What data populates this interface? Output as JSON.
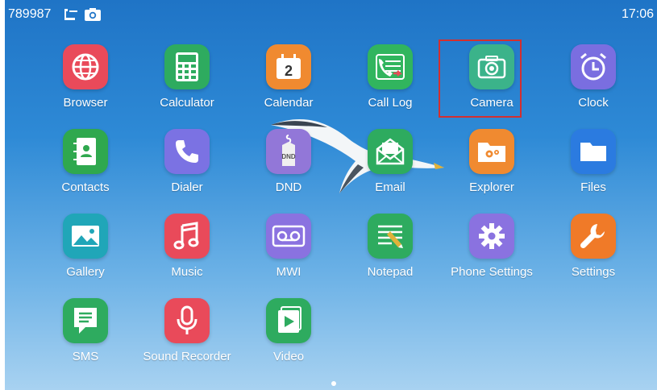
{
  "status_bar": {
    "number": "789987",
    "phone_icon": "phone-handset-icon",
    "camera_icon": "camera-status-icon",
    "time": "17:06"
  },
  "apps": [
    {
      "label": "Browser",
      "icon": "globe-icon",
      "color": "#e94a5a"
    },
    {
      "label": "Calculator",
      "icon": "calculator-icon",
      "color": "#2eab5f"
    },
    {
      "label": "Calendar",
      "icon": "calendar-icon",
      "color": "#f08a30",
      "value": "2"
    },
    {
      "label": "Call Log",
      "icon": "call-log-icon",
      "color": "#31b55e"
    },
    {
      "label": "Camera",
      "icon": "camera-icon",
      "color": "#3bb38a"
    },
    {
      "label": "Clock",
      "icon": "alarm-clock-icon",
      "color": "#7a6ee0"
    },
    {
      "label": "Contacts",
      "icon": "contacts-book-icon",
      "color": "#2fa84e"
    },
    {
      "label": "Dialer",
      "icon": "phone-icon",
      "color": "#7b72e3"
    },
    {
      "label": "DND",
      "icon": "dnd-tag-icon",
      "color": "#9277d8",
      "value": "DND"
    },
    {
      "label": "Email",
      "icon": "envelope-icon",
      "color": "#2eab5f"
    },
    {
      "label": "Explorer",
      "icon": "folder-gears-icon",
      "color": "#f08a30"
    },
    {
      "label": "Files",
      "icon": "folder-icon",
      "color": "#2b7be0"
    },
    {
      "label": "Gallery",
      "icon": "picture-icon",
      "color": "#20a6b8"
    },
    {
      "label": "Music",
      "icon": "music-note-icon",
      "color": "#e94a5a"
    },
    {
      "label": "MWI",
      "icon": "voicemail-icon",
      "color": "#8a72e0"
    },
    {
      "label": "Notepad",
      "icon": "notepad-icon",
      "color": "#2eab5f"
    },
    {
      "label": "Phone Settings",
      "icon": "gear-icon",
      "color": "#8a72e0"
    },
    {
      "label": "Settings",
      "icon": "wrench-icon",
      "color": "#f07a28"
    },
    {
      "label": "SMS",
      "icon": "message-icon",
      "color": "#2eab5f"
    },
    {
      "label": "Sound Recorder",
      "icon": "microphone-icon",
      "color": "#e94a5a"
    },
    {
      "label": "Video",
      "icon": "play-icon",
      "color": "#2eab5f"
    }
  ],
  "highlight_color": "#d32f2f"
}
